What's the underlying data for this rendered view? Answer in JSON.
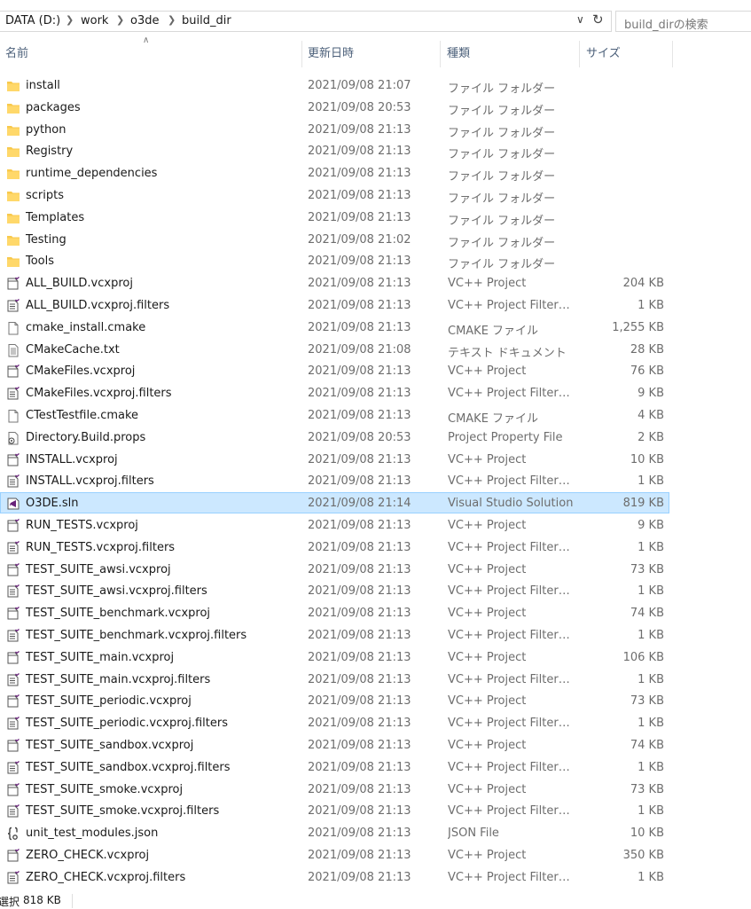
{
  "breadcrumb": [
    {
      "label": "DATA (D:)"
    },
    {
      "label": "work"
    },
    {
      "label": "o3de"
    },
    {
      "label": "build_dir"
    }
  ],
  "search": {
    "placeholder": "build_dirの検索"
  },
  "columns": {
    "name": "名前",
    "date": "更新日時",
    "type": "種類",
    "size": "サイズ"
  },
  "sort": {
    "column": "name",
    "direction": "ascending"
  },
  "files": [
    {
      "name": "install",
      "date": "2021/09/08 21:07",
      "type": "ファイル フォルダー",
      "size": "",
      "icon": "folder-icon"
    },
    {
      "name": "packages",
      "date": "2021/09/08 20:53",
      "type": "ファイル フォルダー",
      "size": "",
      "icon": "folder-icon"
    },
    {
      "name": "python",
      "date": "2021/09/08 21:13",
      "type": "ファイル フォルダー",
      "size": "",
      "icon": "folder-icon"
    },
    {
      "name": "Registry",
      "date": "2021/09/08 21:13",
      "type": "ファイル フォルダー",
      "size": "",
      "icon": "folder-icon"
    },
    {
      "name": "runtime_dependencies",
      "date": "2021/09/08 21:13",
      "type": "ファイル フォルダー",
      "size": "",
      "icon": "folder-icon"
    },
    {
      "name": "scripts",
      "date": "2021/09/08 21:13",
      "type": "ファイル フォルダー",
      "size": "",
      "icon": "folder-icon"
    },
    {
      "name": "Templates",
      "date": "2021/09/08 21:13",
      "type": "ファイル フォルダー",
      "size": "",
      "icon": "folder-icon"
    },
    {
      "name": "Testing",
      "date": "2021/09/08 21:02",
      "type": "ファイル フォルダー",
      "size": "",
      "icon": "folder-icon"
    },
    {
      "name": "Tools",
      "date": "2021/09/08 21:13",
      "type": "ファイル フォルダー",
      "size": "",
      "icon": "folder-icon"
    },
    {
      "name": "ALL_BUILD.vcxproj",
      "date": "2021/09/08 21:13",
      "type": "VC++ Project",
      "size": "204 KB",
      "icon": "vcxproj-icon"
    },
    {
      "name": "ALL_BUILD.vcxproj.filters",
      "date": "2021/09/08 21:13",
      "type": "VC++ Project Filters F...",
      "size": "1 KB",
      "icon": "filters-icon"
    },
    {
      "name": "cmake_install.cmake",
      "date": "2021/09/08 21:13",
      "type": "CMAKE ファイル",
      "size": "1,255 KB",
      "icon": "blank-file-icon"
    },
    {
      "name": "CMakeCache.txt",
      "date": "2021/09/08 21:08",
      "type": "テキスト ドキュメント",
      "size": "28 KB",
      "icon": "text-file-icon"
    },
    {
      "name": "CMakeFiles.vcxproj",
      "date": "2021/09/08 21:13",
      "type": "VC++ Project",
      "size": "76 KB",
      "icon": "vcxproj-icon"
    },
    {
      "name": "CMakeFiles.vcxproj.filters",
      "date": "2021/09/08 21:13",
      "type": "VC++ Project Filters F...",
      "size": "9 KB",
      "icon": "filters-icon"
    },
    {
      "name": "CTestTestfile.cmake",
      "date": "2021/09/08 21:13",
      "type": "CMAKE ファイル",
      "size": "4 KB",
      "icon": "blank-file-icon"
    },
    {
      "name": "Directory.Build.props",
      "date": "2021/09/08 20:53",
      "type": "Project Property File",
      "size": "2 KB",
      "icon": "props-icon"
    },
    {
      "name": "INSTALL.vcxproj",
      "date": "2021/09/08 21:13",
      "type": "VC++ Project",
      "size": "10 KB",
      "icon": "vcxproj-icon"
    },
    {
      "name": "INSTALL.vcxproj.filters",
      "date": "2021/09/08 21:13",
      "type": "VC++ Project Filters F...",
      "size": "1 KB",
      "icon": "filters-icon"
    },
    {
      "name": "O3DE.sln",
      "date": "2021/09/08 21:14",
      "type": "Visual Studio Solution",
      "size": "819 KB",
      "icon": "sln-icon",
      "selected": true
    },
    {
      "name": "RUN_TESTS.vcxproj",
      "date": "2021/09/08 21:13",
      "type": "VC++ Project",
      "size": "9 KB",
      "icon": "vcxproj-icon"
    },
    {
      "name": "RUN_TESTS.vcxproj.filters",
      "date": "2021/09/08 21:13",
      "type": "VC++ Project Filters F...",
      "size": "1 KB",
      "icon": "filters-icon"
    },
    {
      "name": "TEST_SUITE_awsi.vcxproj",
      "date": "2021/09/08 21:13",
      "type": "VC++ Project",
      "size": "73 KB",
      "icon": "vcxproj-icon"
    },
    {
      "name": "TEST_SUITE_awsi.vcxproj.filters",
      "date": "2021/09/08 21:13",
      "type": "VC++ Project Filters F...",
      "size": "1 KB",
      "icon": "filters-icon"
    },
    {
      "name": "TEST_SUITE_benchmark.vcxproj",
      "date": "2021/09/08 21:13",
      "type": "VC++ Project",
      "size": "74 KB",
      "icon": "vcxproj-icon"
    },
    {
      "name": "TEST_SUITE_benchmark.vcxproj.filters",
      "date": "2021/09/08 21:13",
      "type": "VC++ Project Filters F...",
      "size": "1 KB",
      "icon": "filters-icon"
    },
    {
      "name": "TEST_SUITE_main.vcxproj",
      "date": "2021/09/08 21:13",
      "type": "VC++ Project",
      "size": "106 KB",
      "icon": "vcxproj-icon"
    },
    {
      "name": "TEST_SUITE_main.vcxproj.filters",
      "date": "2021/09/08 21:13",
      "type": "VC++ Project Filters F...",
      "size": "1 KB",
      "icon": "filters-icon"
    },
    {
      "name": "TEST_SUITE_periodic.vcxproj",
      "date": "2021/09/08 21:13",
      "type": "VC++ Project",
      "size": "73 KB",
      "icon": "vcxproj-icon"
    },
    {
      "name": "TEST_SUITE_periodic.vcxproj.filters",
      "date": "2021/09/08 21:13",
      "type": "VC++ Project Filters F...",
      "size": "1 KB",
      "icon": "filters-icon"
    },
    {
      "name": "TEST_SUITE_sandbox.vcxproj",
      "date": "2021/09/08 21:13",
      "type": "VC++ Project",
      "size": "74 KB",
      "icon": "vcxproj-icon"
    },
    {
      "name": "TEST_SUITE_sandbox.vcxproj.filters",
      "date": "2021/09/08 21:13",
      "type": "VC++ Project Filters F...",
      "size": "1 KB",
      "icon": "filters-icon"
    },
    {
      "name": "TEST_SUITE_smoke.vcxproj",
      "date": "2021/09/08 21:13",
      "type": "VC++ Project",
      "size": "73 KB",
      "icon": "vcxproj-icon"
    },
    {
      "name": "TEST_SUITE_smoke.vcxproj.filters",
      "date": "2021/09/08 21:13",
      "type": "VC++ Project Filters F...",
      "size": "1 KB",
      "icon": "filters-icon"
    },
    {
      "name": "unit_test_modules.json",
      "date": "2021/09/08 21:13",
      "type": "JSON File",
      "size": "10 KB",
      "icon": "json-icon"
    },
    {
      "name": "ZERO_CHECK.vcxproj",
      "date": "2021/09/08 21:13",
      "type": "VC++ Project",
      "size": "350 KB",
      "icon": "vcxproj-icon"
    },
    {
      "name": "ZERO_CHECK.vcxproj.filters",
      "date": "2021/09/08 21:13",
      "type": "VC++ Project Filters F...",
      "size": "1 KB",
      "icon": "filters-icon"
    }
  ],
  "status": {
    "selected_label": "選択",
    "selected_size": "818 KB"
  },
  "colors": {
    "selection_bg": "#cce8ff",
    "selection_border": "#99d1ff",
    "folder": "#f8c94c",
    "vs_purple": "#68217a"
  }
}
